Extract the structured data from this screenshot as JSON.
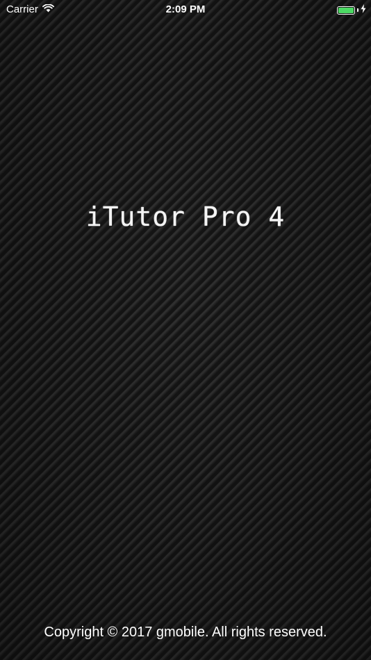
{
  "status_bar": {
    "carrier": "Carrier",
    "time": "2:09 PM",
    "battery_level": 1.0,
    "battery_color": "#4cd964",
    "icons": [
      "wifi-icon",
      "battery-icon",
      "charging-bolt-icon"
    ]
  },
  "splash": {
    "title": "iTutor Pro 4",
    "copyright": "Copyright © 2017 gmobile. All rights reserved."
  },
  "colors": {
    "text": "#ffffff",
    "background": "#1d1d1d"
  }
}
